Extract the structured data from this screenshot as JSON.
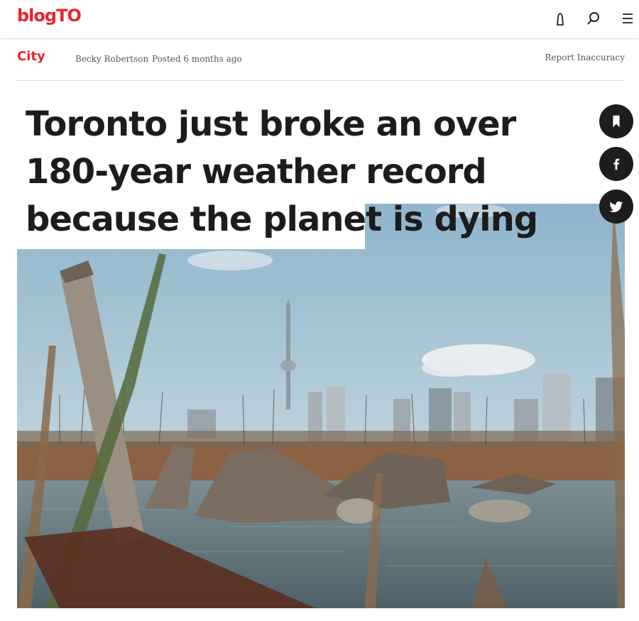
{
  "header": {
    "logo": "blogTO",
    "icons": [
      "user-icon",
      "search-icon",
      "menu-icon"
    ]
  },
  "meta": {
    "category": "City",
    "author": "Becky Robertson",
    "posted": "Posted 6 months ago",
    "report": "Report Inaccuracy"
  },
  "article": {
    "title": "Toronto just broke an over 180-year weather record because the planet is dying"
  },
  "share": {
    "icons": [
      "bookmark-icon",
      "facebook-icon",
      "twitter-icon"
    ]
  },
  "colors": {
    "brand": "#e8252a",
    "dark": "#1d1d1d"
  }
}
